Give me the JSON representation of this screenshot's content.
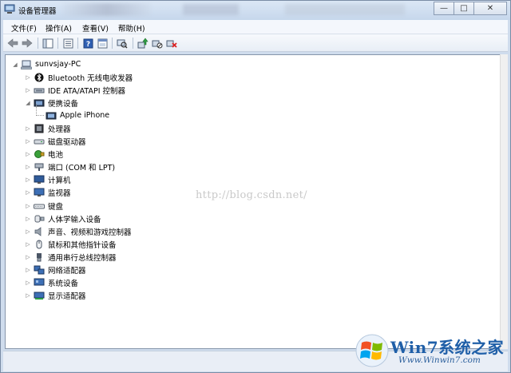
{
  "window": {
    "title": "设备管理器"
  },
  "caption": {
    "minimize": "—",
    "maximize": "□",
    "close": "✕"
  },
  "menu": [
    "文件(F)",
    "操作(A)",
    "查看(V)",
    "帮助(H)"
  ],
  "toolbar": [
    "back-icon",
    "forward-icon",
    "show-hide-tree-icon",
    "properties-icon",
    "help-icon",
    "view-icon",
    "scan-hardware-icon",
    "update-driver-icon",
    "disable-device-icon",
    "uninstall-icon"
  ],
  "tree": {
    "root": "sunvsjay-PC",
    "items": [
      {
        "label": "Bluetooth 无线电收发器",
        "icon": "bluetooth-icon",
        "expanded": false
      },
      {
        "label": "IDE ATA/ATAPI 控制器",
        "icon": "ide-controller-icon",
        "expanded": false
      },
      {
        "label": "便携设备",
        "icon": "portable-device-icon",
        "expanded": true
      },
      {
        "label": "Apple iPhone",
        "icon": "iphone-device-icon",
        "child": true
      },
      {
        "label": "处理器",
        "icon": "processor-icon",
        "expanded": false
      },
      {
        "label": "磁盘驱动器",
        "icon": "disk-drive-icon",
        "expanded": false
      },
      {
        "label": "电池",
        "icon": "battery-icon",
        "expanded": false
      },
      {
        "label": "端口 (COM 和 LPT)",
        "icon": "port-icon",
        "expanded": false
      },
      {
        "label": "计算机",
        "icon": "computer-icon",
        "expanded": false
      },
      {
        "label": "监视器",
        "icon": "monitor-icon",
        "expanded": false
      },
      {
        "label": "键盘",
        "icon": "keyboard-icon",
        "expanded": false
      },
      {
        "label": "人体学输入设备",
        "icon": "hid-icon",
        "expanded": false
      },
      {
        "label": "声音、视频和游戏控制器",
        "icon": "sound-icon",
        "expanded": false
      },
      {
        "label": "鼠标和其他指针设备",
        "icon": "mouse-icon",
        "expanded": false
      },
      {
        "label": "通用串行总线控制器",
        "icon": "usb-icon",
        "expanded": false
      },
      {
        "label": "网络适配器",
        "icon": "network-adapter-icon",
        "expanded": false
      },
      {
        "label": "系统设备",
        "icon": "system-device-icon",
        "expanded": false
      },
      {
        "label": "显示适配器",
        "icon": "display-adapter-icon",
        "expanded": false
      }
    ]
  },
  "watermark": "http://blog.csdn.net/",
  "logo": {
    "brand": "Win7系统之家",
    "url": "Www.Winwin7.com"
  }
}
